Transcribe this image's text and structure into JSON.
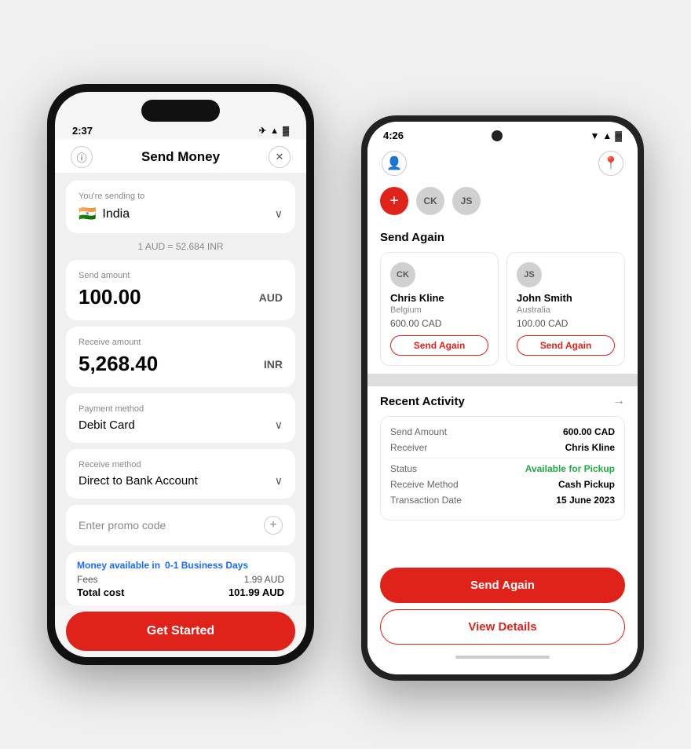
{
  "left_phone": {
    "status_time": "2:37",
    "title": "Send Money",
    "destination_label": "You're sending to",
    "destination_country": "India",
    "destination_flag": "🇮🇳",
    "exchange_rate": "1 AUD = 52.684 INR",
    "send_amount_label": "Send amount",
    "send_amount": "100.00",
    "send_currency": "AUD",
    "receive_amount_label": "Receive amount",
    "receive_amount": "5,268.40",
    "receive_currency": "INR",
    "payment_method_label": "Payment method",
    "payment_method": "Debit Card",
    "receive_method_label": "Receive method",
    "receive_method": "Direct to Bank Account",
    "promo_placeholder": "Enter promo code",
    "money_available_label": "Money available in",
    "business_days": "0-1 Business Days",
    "fees_label": "Fees",
    "fees_value": "1.99 AUD",
    "total_label": "Total cost",
    "total_value": "101.99 AUD",
    "cta_button": "Get Started"
  },
  "right_phone": {
    "status_time": "4:26",
    "contacts": [
      "CK",
      "JS"
    ],
    "send_again_title": "Send Again",
    "send_again_contacts": [
      {
        "initials": "CK",
        "name": "Chris Kline",
        "country": "Belgium",
        "amount": "600.00 CAD",
        "button": "Send Again"
      },
      {
        "initials": "JS",
        "name": "John Smith",
        "country": "Australia",
        "amount": "100.00 CAD",
        "button": "Send Again"
      }
    ],
    "recent_activity_title": "Recent Activity",
    "activity": {
      "send_amount_label": "Send Amount",
      "send_amount_value": "600.00 CAD",
      "receiver_label": "Receiver",
      "receiver_value": "Chris Kline",
      "status_label": "Status",
      "status_value": "Available for Pickup",
      "receive_method_label": "Receive Method",
      "receive_method_value": "Cash Pickup",
      "transaction_date_label": "Transaction Date",
      "transaction_date_value": "15 June 2023"
    },
    "send_again_button": "Send Again",
    "view_details_button": "View Details"
  },
  "colors": {
    "primary_red": "#e0231a",
    "blue": "#1a6aff",
    "green": "#22aa44"
  }
}
